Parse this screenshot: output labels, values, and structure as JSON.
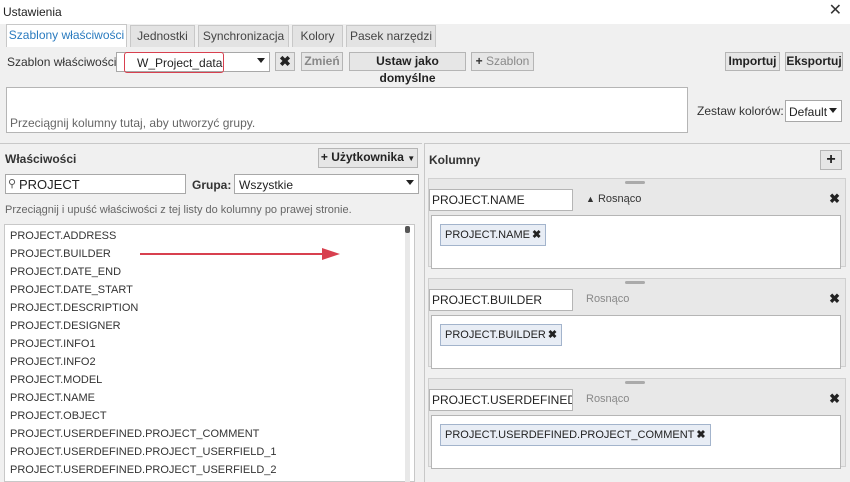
{
  "window": {
    "title": "Ustawienia"
  },
  "tabs": [
    {
      "label": "Szablony właściwości"
    },
    {
      "label": "Jednostki"
    },
    {
      "label": "Synchronizacja"
    },
    {
      "label": "Kolory"
    },
    {
      "label": "Pasek narzędzi"
    }
  ],
  "toolbar": {
    "template_label": "Szablon właściwości:",
    "template_value": "W_Project_data",
    "change_label": "Zmień",
    "set_default_label": "Ustaw jako domyślne",
    "template_add_label": "Szablon",
    "import_label": "Importuj",
    "export_label": "Eksportuj"
  },
  "grouping": {
    "hint": "Przeciągnij kolumny tutaj, aby utworzyć grupy."
  },
  "color_set": {
    "label": "Zestaw kolorów:",
    "value": "Default"
  },
  "properties": {
    "title": "Właściwości",
    "user_button": "Użytkownika",
    "search_value": "PROJECT",
    "group_label": "Grupa:",
    "group_value": "Wszystkie",
    "hint": "Przeciągnij i upuść właściwości z tej listy do kolumny po prawej stronie.",
    "items": [
      "PROJECT.ADDRESS",
      "PROJECT.BUILDER",
      "PROJECT.DATE_END",
      "PROJECT.DATE_START",
      "PROJECT.DESCRIPTION",
      "PROJECT.DESIGNER",
      "PROJECT.INFO1",
      "PROJECT.INFO2",
      "PROJECT.MODEL",
      "PROJECT.NAME",
      "PROJECT.OBJECT",
      "PROJECT.USERDEFINED.PROJECT_COMMENT",
      "PROJECT.USERDEFINED.PROJECT_USERFIELD_1",
      "PROJECT.USERDEFINED.PROJECT_USERFIELD_2"
    ]
  },
  "columns": {
    "title": "Kolumny",
    "blocks": [
      {
        "name": "PROJECT.NAME",
        "sort": "Rosnąco",
        "chip": "PROJECT.NAME"
      },
      {
        "name": "PROJECT.BUILDER",
        "sort": "Rosnąco",
        "chip": "PROJECT.BUILDER"
      },
      {
        "name": "PROJECT.USERDEFINED.P",
        "sort": "Rosnąco",
        "chip": "PROJECT.USERDEFINED.PROJECT_COMMENT"
      }
    ]
  },
  "colors": {
    "accent": "#2a7bbf",
    "highlight": "#d8404f"
  },
  "icons": {
    "close": "close-icon",
    "search": "search-icon",
    "plus": "plus-icon",
    "caret": "caret-down-icon",
    "sort_up": "sort-up-icon",
    "arrow": "arrow-right-icon"
  }
}
